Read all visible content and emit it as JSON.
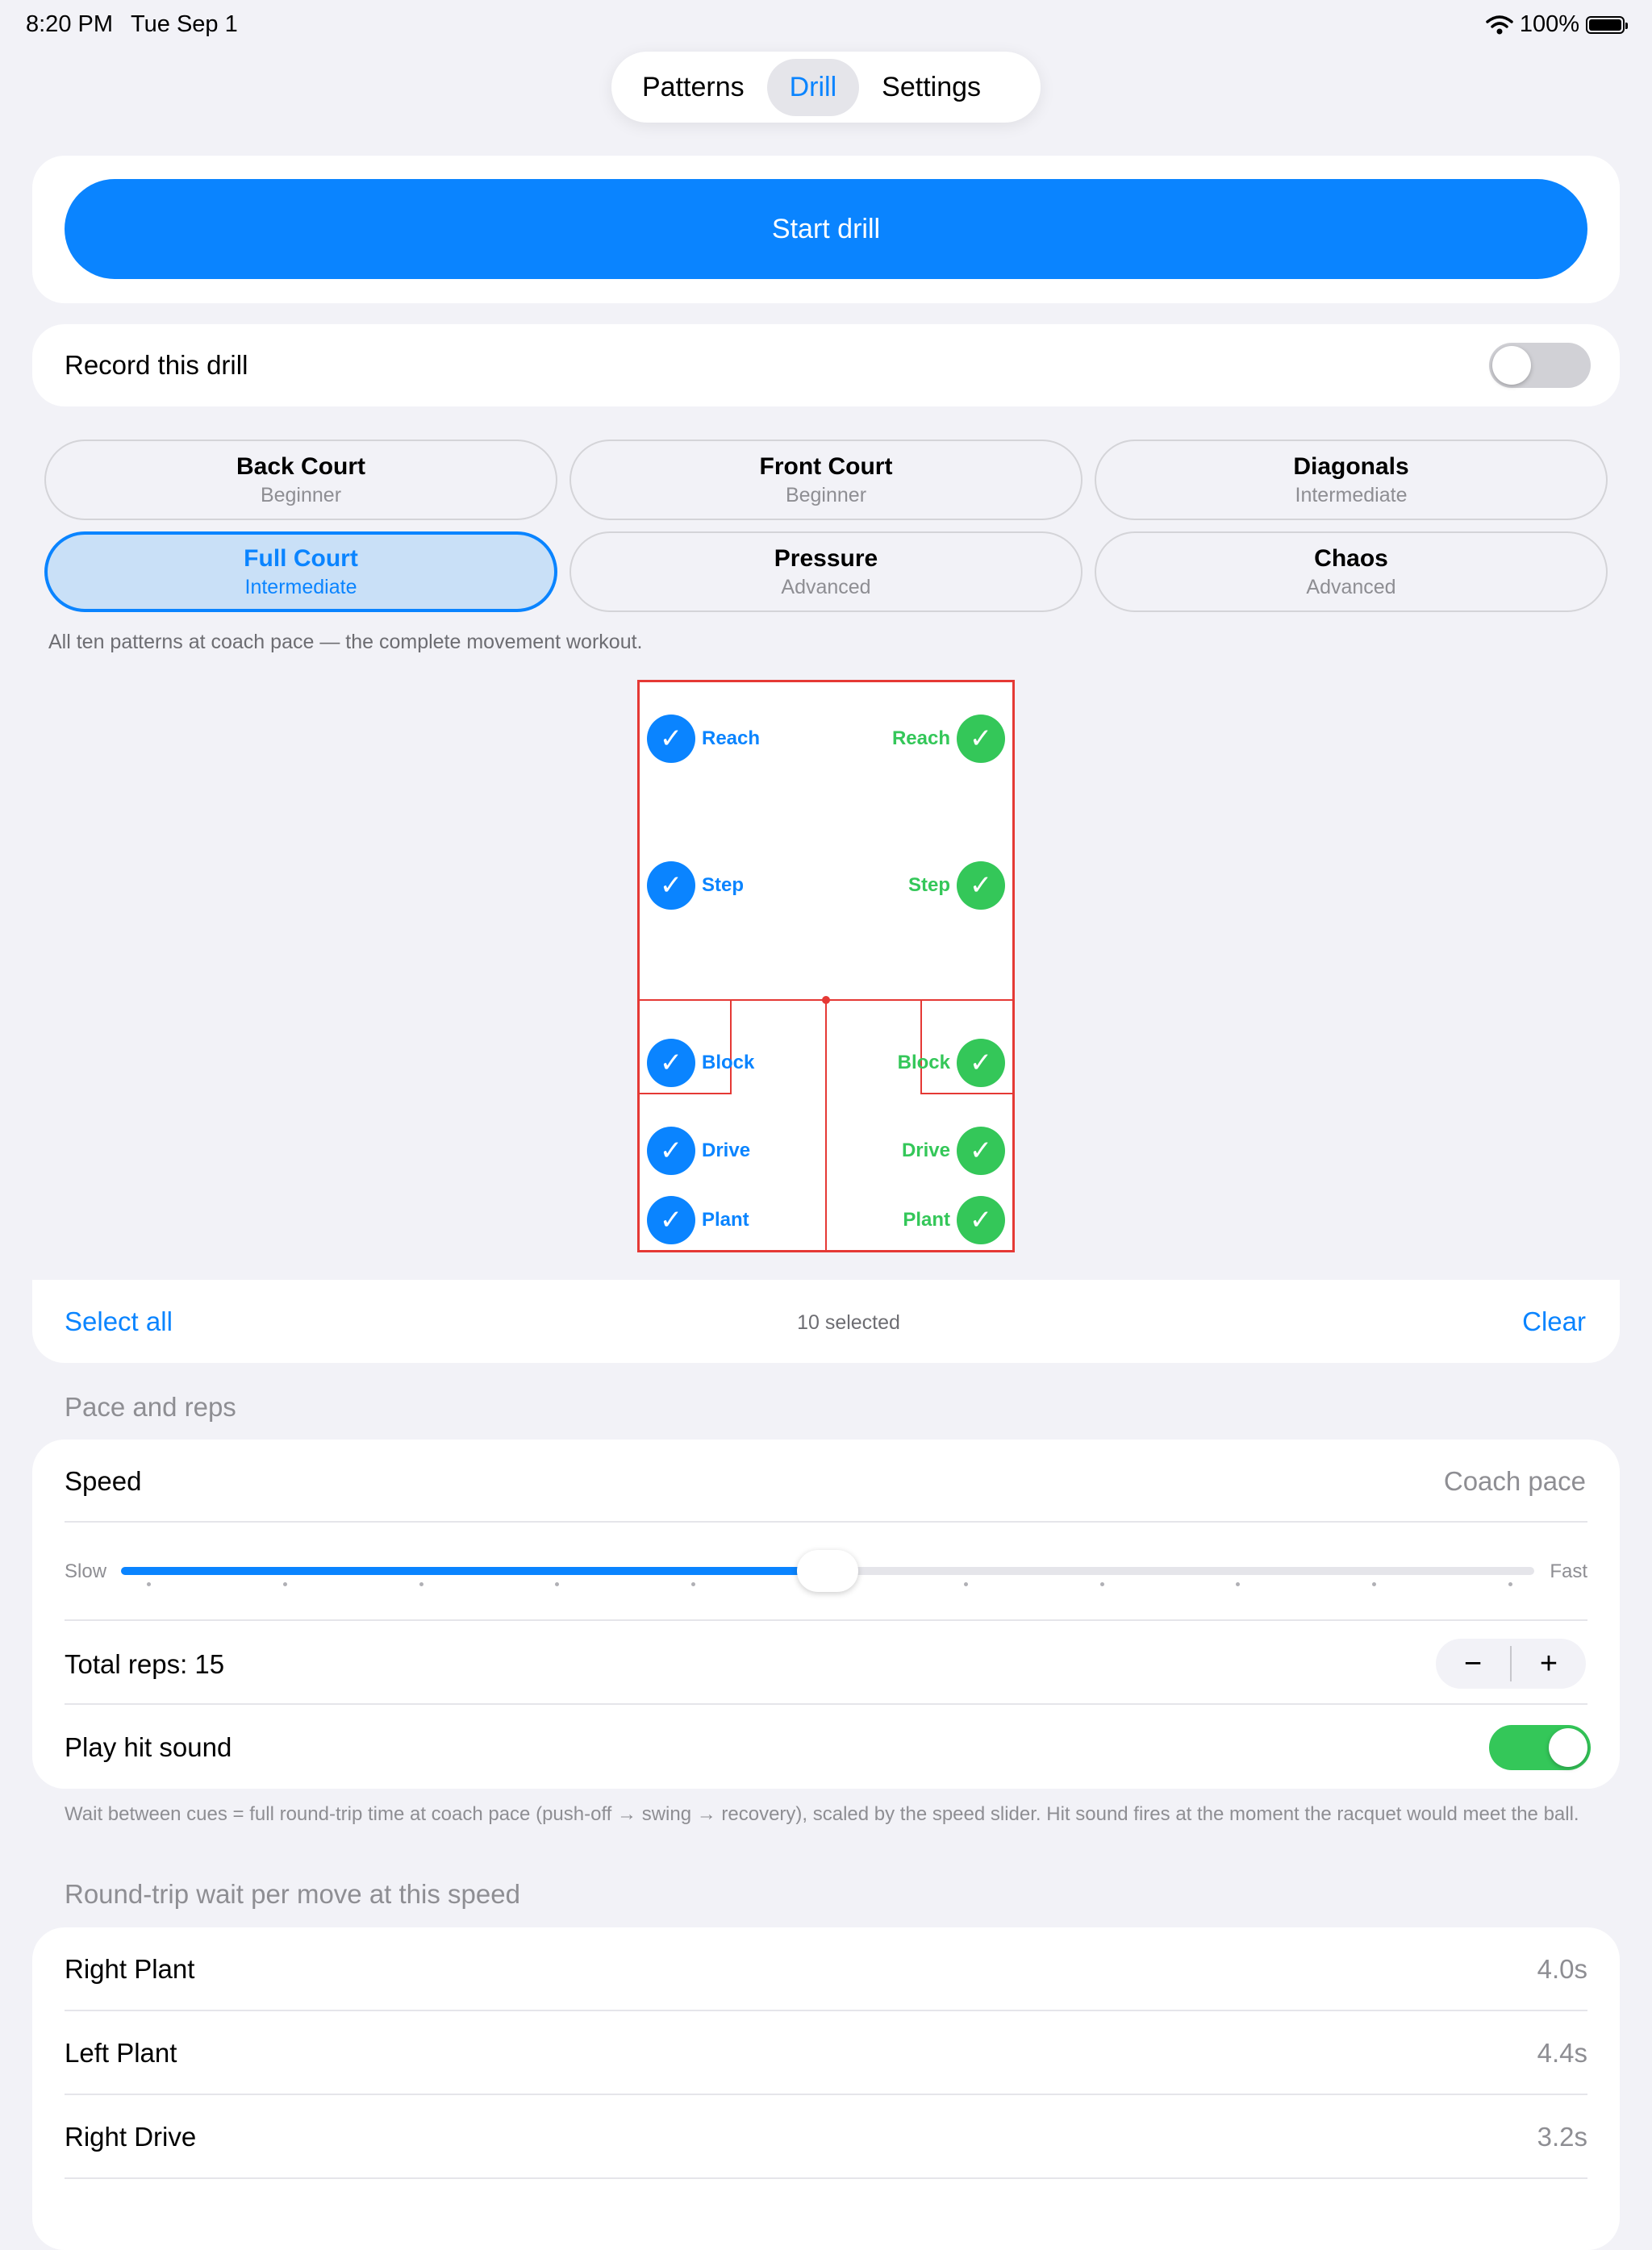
{
  "status_bar": {
    "time": "8:20 PM",
    "date": "Tue Sep 1",
    "battery": "100%"
  },
  "tabs": [
    {
      "label": "Patterns",
      "active": false
    },
    {
      "label": "Drill",
      "active": true
    },
    {
      "label": "Settings",
      "active": false
    }
  ],
  "start_button": "Start drill",
  "record": {
    "label": "Record this drill",
    "on": false
  },
  "presets": [
    {
      "name": "Back Court",
      "level": "Beginner",
      "selected": false
    },
    {
      "name": "Front Court",
      "level": "Beginner",
      "selected": false
    },
    {
      "name": "Diagonals",
      "level": "Intermediate",
      "selected": false
    },
    {
      "name": "Full Court",
      "level": "Intermediate",
      "selected": true
    },
    {
      "name": "Pressure",
      "level": "Advanced",
      "selected": false
    },
    {
      "name": "Chaos",
      "level": "Advanced",
      "selected": false
    }
  ],
  "preset_description": "All ten patterns at coach pace — the complete movement workout.",
  "court": {
    "left_moves": [
      "Reach",
      "Step",
      "Block",
      "Drive",
      "Plant"
    ],
    "right_moves": [
      "Reach",
      "Step",
      "Block",
      "Drive",
      "Plant"
    ],
    "colors": {
      "left": "#0a84ff",
      "right": "#34c759",
      "lines": "#e53935"
    }
  },
  "selection": {
    "select_all": "Select all",
    "count": "10 selected",
    "clear": "Clear"
  },
  "pace": {
    "section_title": "Pace and reps",
    "speed_label": "Speed",
    "speed_value": "Coach pace",
    "slider": {
      "min_label": "Slow",
      "max_label": "Fast",
      "value": 0.5
    },
    "reps_label": "Total reps: 15",
    "stepper": {
      "minus": "−",
      "plus": "+"
    },
    "hit_sound_label": "Play hit sound",
    "hit_sound_on": true
  },
  "footnote": "Wait between cues = full round-trip time at coach pace (push-off → swing → recovery), scaled by the speed slider. Hit sound fires at the moment the racquet would meet the ball.",
  "wait": {
    "section_title": "Round-trip wait per move at this speed",
    "rows": [
      {
        "name": "Right Plant",
        "value": "4.0s"
      },
      {
        "name": "Left Plant",
        "value": "4.4s"
      },
      {
        "name": "Right Drive",
        "value": "3.2s"
      }
    ]
  }
}
